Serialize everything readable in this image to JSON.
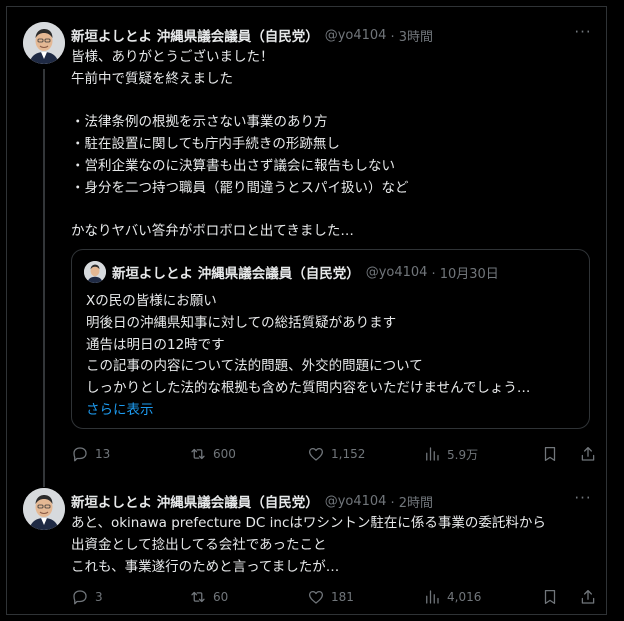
{
  "posts": [
    {
      "author": "新垣よしとよ 沖縄県議会議員（自民党）",
      "handle": "@yo4104",
      "time": "· 3時間",
      "more": "···",
      "lines": [
        "皆様、ありがとうございました！",
        "午前中で質疑を終えました",
        "",
        "・法律条例の根拠を示さない事業のあり方",
        "・駐在設置に関しても庁内手続きの形跡無し",
        "・営利企業なのに決算書も出さず議会に報告もしない",
        "・身分を二つ持つ職員（罷り間違うとスパイ扱い）など",
        "",
        "かなりヤバい答弁がボロボロと出てきました…"
      ],
      "quote": {
        "author": "新垣よしとよ 沖縄県議会議員（自民党）",
        "handle": "@yo4104",
        "time": "· 10月30日",
        "lines": [
          "Xの民の皆様にお願い",
          "明後日の沖縄県知事に対しての総括質疑があります",
          "通告は明日の12時です",
          "この記事の内容について法的問題、外交的問題について",
          "しっかりとした法的な根拠も含めた質問内容をいただけませんでしょう…"
        ],
        "show_more": "さらに表示"
      },
      "stats": {
        "replies": "13",
        "reposts": "600",
        "likes": "1,152",
        "views": "5.9万"
      }
    },
    {
      "author": "新垣よしとよ 沖縄県議会議員（自民党）",
      "handle": "@yo4104",
      "time": "· 2時間",
      "more": "···",
      "lines": [
        "あと、okinawa prefecture DC incはワシントン駐在に係る事業の委託料から",
        "出資金として捻出してる会社であったこと",
        "これも、事業遂行のためと言ってましたが…"
      ],
      "stats": {
        "replies": "3",
        "reposts": "60",
        "likes": "181",
        "views": "4,016"
      }
    }
  ],
  "colors": {
    "background": "#000000",
    "text": "#e7e9ea",
    "muted": "#71767b",
    "link": "#1d9bf0",
    "border": "#2f3336"
  },
  "icons": [
    "avatar",
    "more-icon",
    "reply-icon",
    "repost-icon",
    "like-icon",
    "views-icon",
    "bookmark-icon",
    "share-icon"
  ]
}
